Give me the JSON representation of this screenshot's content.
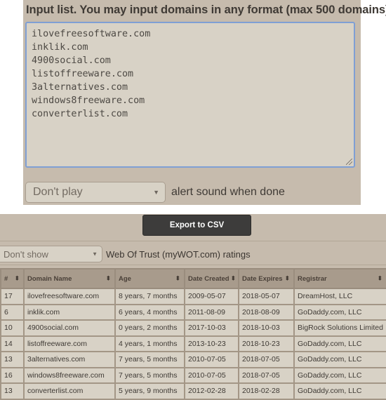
{
  "input_section": {
    "heading": "Input list. You may input domains in any format (max 500 domains)",
    "domains_text": "ilovefreesoftware.com\ninklik.com\n4900social.com\nlistoffreeware.com\n3alternatives.com\nwindows8freeware.com\nconverterlist.com",
    "sound_select": {
      "value": "Don't play",
      "arrow_icon": "triangle-down"
    },
    "sound_label": "alert sound when done"
  },
  "results_section": {
    "export_button": "Export to CSV",
    "wot_select": {
      "value": "Don't show",
      "arrow_icon": "triangle-down"
    },
    "wot_label": "Web Of Trust (myWOT.com) ratings",
    "table": {
      "columns": [
        "#",
        "Domain Name",
        "Age",
        "Date Created",
        "Date Expires",
        "Registrar"
      ],
      "sort_icon": "sort-up-down",
      "rows": [
        [
          "17",
          "ilovefreesoftware.com",
          "8 years, 7 months",
          "2009-05-07",
          "2018-05-07",
          "DreamHost, LLC"
        ],
        [
          "6",
          "inklik.com",
          "6 years, 4 months",
          "2011-08-09",
          "2018-08-09",
          "GoDaddy.com, LLC"
        ],
        [
          "10",
          "4900social.com",
          "0 years, 2 months",
          "2017-10-03",
          "2018-10-03",
          "BigRock Solutions Limited"
        ],
        [
          "14",
          "listoffreeware.com",
          "4 years, 1 months",
          "2013-10-23",
          "2018-10-23",
          "GoDaddy.com, LLC"
        ],
        [
          "13",
          "3alternatives.com",
          "7 years, 5 months",
          "2010-07-05",
          "2018-07-05",
          "GoDaddy.com, LLC"
        ],
        [
          "16",
          "windows8freeware.com",
          "7 years, 5 months",
          "2010-07-05",
          "2018-07-05",
          "GoDaddy.com, LLC"
        ],
        [
          "13",
          "converterlist.com",
          "5 years, 9 months",
          "2012-02-28",
          "2018-02-28",
          "GoDaddy.com, LLC"
        ]
      ]
    }
  },
  "colors": {
    "panel_bg": "#c6bbad",
    "input_bg": "#d8d2c6",
    "textarea_focus_border": "#7f9fd4",
    "button_bg": "#3d3c3b",
    "table_header_bg": "#a89b8c"
  }
}
